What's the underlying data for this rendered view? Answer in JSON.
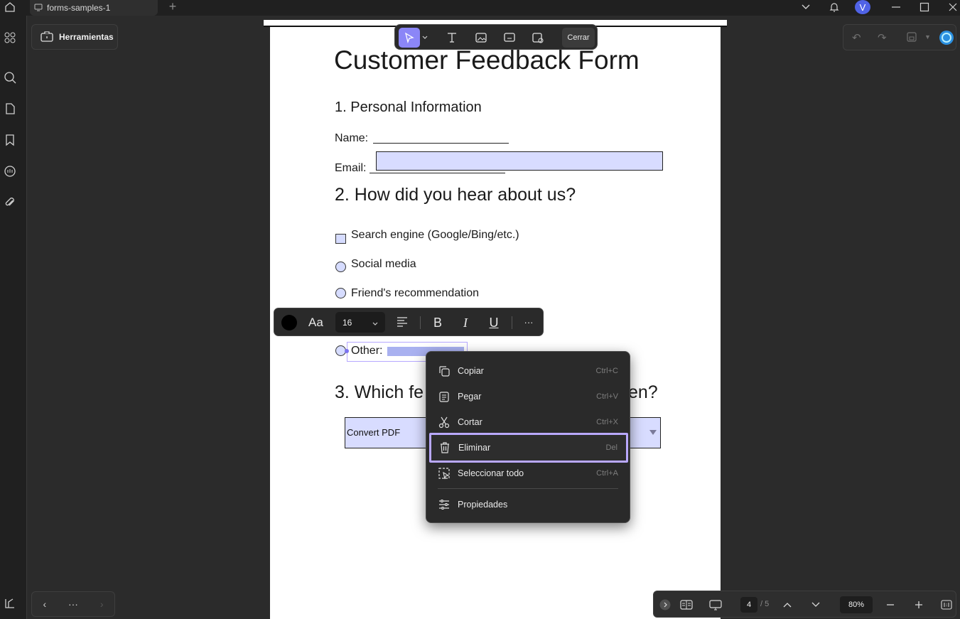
{
  "titlebar": {
    "tab_label": "forms-samples-1",
    "avatar_initial": "V"
  },
  "sidebar": {
    "tools_label": "Herramientas",
    "nav_more": "···"
  },
  "toolbar": {
    "close_label": "Cerrar"
  },
  "document": {
    "title": "Customer Feedback Form",
    "section1": "1. Personal Information",
    "name_label": "Name: ",
    "email_label": "Email: ",
    "section2": "2. How did you hear about us?",
    "options": [
      "Search engine (Google/Bing/etc.)",
      "Social media",
      "Friend's recommendation"
    ],
    "other_label": "Other:",
    "section3_start": "3. Which fe",
    "section3_end": "ten?",
    "combo_value": "Convert PDF"
  },
  "format_bar": {
    "font_glyph": "Aa",
    "font_size": "16",
    "bold": "B",
    "italic": "I",
    "underline": "U",
    "more": "···"
  },
  "context_menu": {
    "items": [
      {
        "label": "Copiar",
        "shortcut": "Ctrl+C"
      },
      {
        "label": "Pegar",
        "shortcut": "Ctrl+V"
      },
      {
        "label": "Cortar",
        "shortcut": "Ctrl+X"
      },
      {
        "label": "Eliminar",
        "shortcut": "Del"
      },
      {
        "label": "Seleccionar todo",
        "shortcut": "Ctrl+A"
      },
      {
        "label": "Propiedades",
        "shortcut": ""
      }
    ]
  },
  "bottom_nav": {
    "current_page": "4",
    "total_pages": "/ 5",
    "zoom": "80%"
  },
  "colors": {
    "accent": "#8b86f7",
    "field_fill": "#d8dcff",
    "highlight_border": "#b9a8ff"
  }
}
